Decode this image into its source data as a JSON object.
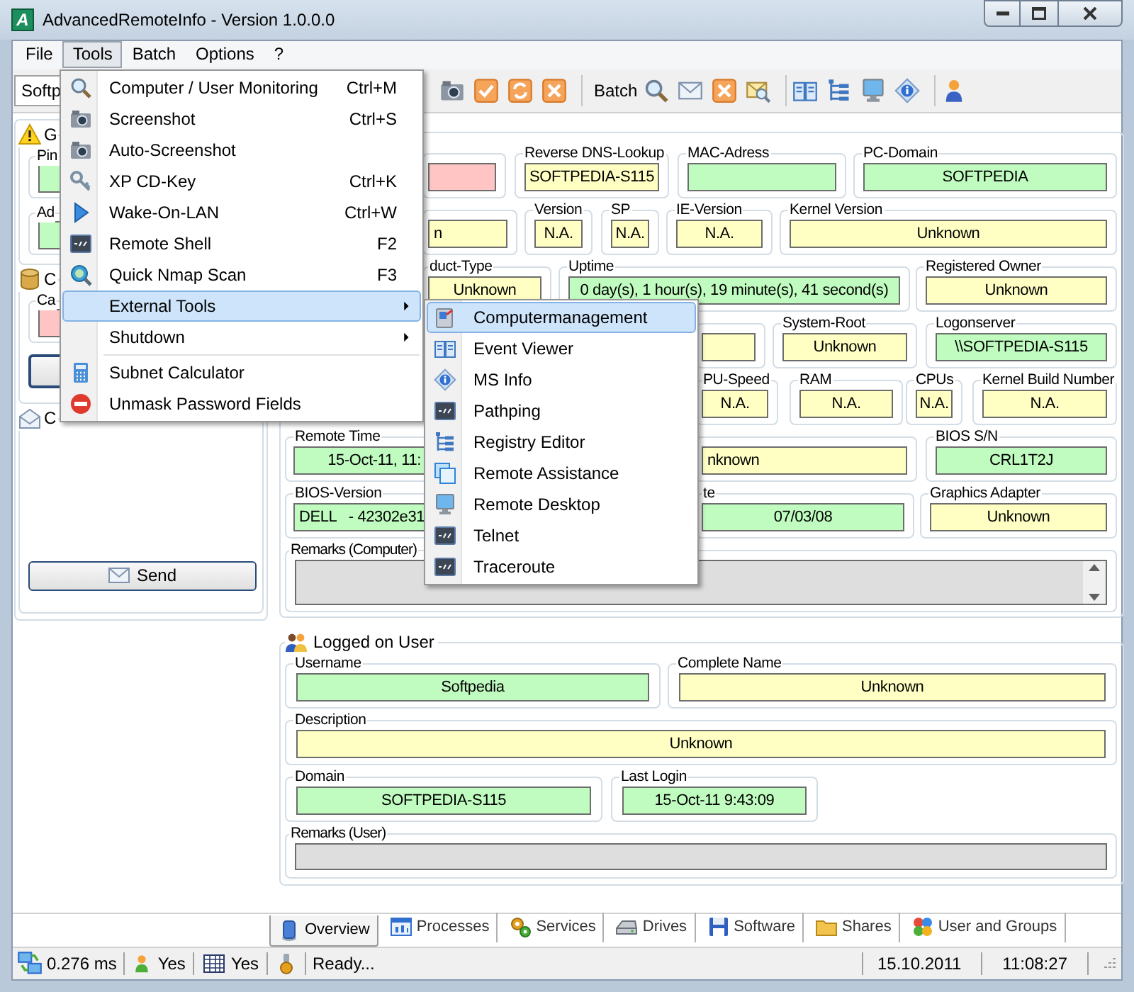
{
  "window": {
    "logo": "A",
    "title": "AdvancedRemoteInfo - Version 1.0.0.0"
  },
  "menu_bar": [
    {
      "label": "File",
      "selected": false
    },
    {
      "label": "Tools",
      "selected": true
    },
    {
      "label": "Batch",
      "selected": false
    },
    {
      "label": "Options",
      "selected": false
    },
    {
      "label": "?",
      "selected": false
    }
  ],
  "tools_menu": [
    {
      "kind": "item",
      "label": "Computer / User Monitoring",
      "shortcut": "Ctrl+M",
      "selected": false
    },
    {
      "kind": "item",
      "label": "Screenshot",
      "shortcut": "Ctrl+S",
      "selected": false
    },
    {
      "kind": "item",
      "label": "Auto-Screenshot",
      "selected": false
    },
    {
      "kind": "item",
      "label": "XP CD-Key",
      "shortcut": "Ctrl+K",
      "selected": false
    },
    {
      "kind": "item",
      "label": "Wake-On-LAN",
      "shortcut": "Ctrl+W",
      "selected": false
    },
    {
      "kind": "item",
      "label": "Remote Shell",
      "shortcut": "F2",
      "selected": false
    },
    {
      "kind": "item",
      "label": "Quick Nmap Scan",
      "shortcut": "F3",
      "selected": false
    },
    {
      "kind": "submenu",
      "label": "External Tools",
      "selected": true
    },
    {
      "kind": "submenu",
      "label": "Shutdown",
      "selected": false
    },
    {
      "kind": "separator"
    },
    {
      "kind": "item",
      "label": "Subnet Calculator",
      "selected": false
    },
    {
      "kind": "item",
      "label": "Unmask Password Fields",
      "selected": false
    }
  ],
  "external_tools_menu": [
    {
      "label": "Computermanagement",
      "selected": true
    },
    {
      "label": "Event Viewer",
      "selected": false
    },
    {
      "label": "MS Info",
      "selected": false
    },
    {
      "label": "Pathping",
      "selected": false
    },
    {
      "label": "Registry Editor",
      "selected": false
    },
    {
      "label": "Remote Assistance",
      "selected": false
    },
    {
      "label": "Remote Desktop",
      "selected": false
    },
    {
      "label": "Telnet",
      "selected": false
    },
    {
      "label": "Traceroute",
      "selected": false
    }
  ],
  "toolbar": {
    "host_field": "Softp",
    "batch_label": "Batch"
  },
  "left_panel": {
    "groups": [
      {
        "title": "G",
        "fields": [
          {
            "label": "Pin",
            "color": "#c0fcc0"
          },
          {
            "label": "Ad",
            "color": "#c0fcc0"
          }
        ]
      },
      {
        "title": "C",
        "fields": [
          {
            "label": "Ca",
            "color": "#ffc4c4"
          }
        ]
      },
      {
        "title": "C"
      }
    ],
    "send_button": "Send"
  },
  "computer": {
    "rows": [
      [
        {
          "color": "#ffc4c4"
        },
        {
          "label": "Reverse DNS-Lookup",
          "value": "SOFTPEDIA-S115",
          "color": "#ffffc4"
        },
        {
          "label": "MAC-Adress",
          "color": "#c0fcc0"
        },
        {
          "label": "PC-Domain",
          "value": "SOFTPEDIA",
          "color": "#c0fcc0"
        }
      ],
      [
        {
          "value": "n",
          "color": "#ffffc4"
        },
        {
          "label": "Version",
          "value": "N.A.",
          "color": "#ffffc4"
        },
        {
          "label": "SP",
          "value": "N.A.",
          "color": "#ffffc4"
        },
        {
          "label": "IE-Version",
          "value": "N.A.",
          "color": "#ffffc4"
        },
        {
          "label": "Kernel Version",
          "value": "Unknown",
          "color": "#ffffc4"
        }
      ],
      [
        {
          "label": "duct-Type",
          "value": "Unknown",
          "color": "#ffffc4"
        },
        {
          "label": "Uptime",
          "value": "0 day(s), 1 hour(s), 19 minute(s), 41 second(s)",
          "color": "#c0fcc0"
        },
        {
          "label": "Registered Owner",
          "value": "Unknown",
          "color": "#ffffc4"
        }
      ],
      [
        {
          "color": "#ffffc4"
        },
        {
          "label": "System-Root",
          "value": "Unknown",
          "color": "#ffffc4"
        },
        {
          "label": "Logonserver",
          "value": "\\\\SOFTPEDIA-S115",
          "color": "#c0fcc0"
        }
      ],
      [
        {
          "label": "PU-Speed",
          "value": "N.A.",
          "color": "#ffffc4"
        },
        {
          "label": "RAM",
          "value": "N.A.",
          "color": "#ffffc4"
        },
        {
          "label": "CPUs",
          "value": "N.A.",
          "color": "#ffffc4"
        },
        {
          "label": "Kernel Build Number",
          "value": "N.A.",
          "color": "#ffffc4"
        }
      ],
      [
        {
          "label": "Remote Time",
          "value": "15-Oct-11, 11:",
          "color": "#c0fcc0"
        },
        {
          "value": "nknown",
          "color": "#ffffc4"
        },
        {
          "label": "BIOS S/N",
          "value": "CRL1T2J",
          "color": "#c0fcc0"
        }
      ],
      [
        {
          "label": "BIOS-Version",
          "value": "DELL   - 42302e31",
          "color": "#c0fcc0"
        },
        {
          "label": "te",
          "value": "07/03/08",
          "color": "#c0fcc0"
        },
        {
          "label": "Graphics Adapter",
          "value": "Unknown",
          "color": "#ffffc4"
        }
      ]
    ],
    "remarks_label": "Remarks (Computer)"
  },
  "user": {
    "title": "Logged on User",
    "rows": [
      [
        {
          "label": "Username",
          "value": "Softpedia",
          "color": "#c0fcc0"
        },
        {
          "label": "Complete Name",
          "value": "Unknown",
          "color": "#ffffc4"
        }
      ],
      [
        {
          "label": "Description",
          "value": "Unknown",
          "color": "#ffffc4"
        }
      ],
      [
        {
          "label": "Domain",
          "value": "SOFTPEDIA-S115",
          "color": "#c0fcc0"
        },
        {
          "label": "Last Login",
          "value": "15-Oct-11 9:43:09",
          "color": "#c0fcc0"
        }
      ]
    ],
    "remarks_label": "Remarks (User)"
  },
  "tabs": [
    {
      "label": "Overview",
      "selected": true
    },
    {
      "label": "Processes",
      "selected": false
    },
    {
      "label": "Services",
      "selected": false
    },
    {
      "label": "Drives",
      "selected": false
    },
    {
      "label": "Software",
      "selected": false
    },
    {
      "label": "Shares",
      "selected": false
    },
    {
      "label": "User and Groups",
      "selected": false
    }
  ],
  "status_bar": {
    "ping": "0.276 ms",
    "user_status": "Yes",
    "table_status": "Yes",
    "message": "Ready...",
    "date": "15.10.2011",
    "time": "11:08:27"
  }
}
